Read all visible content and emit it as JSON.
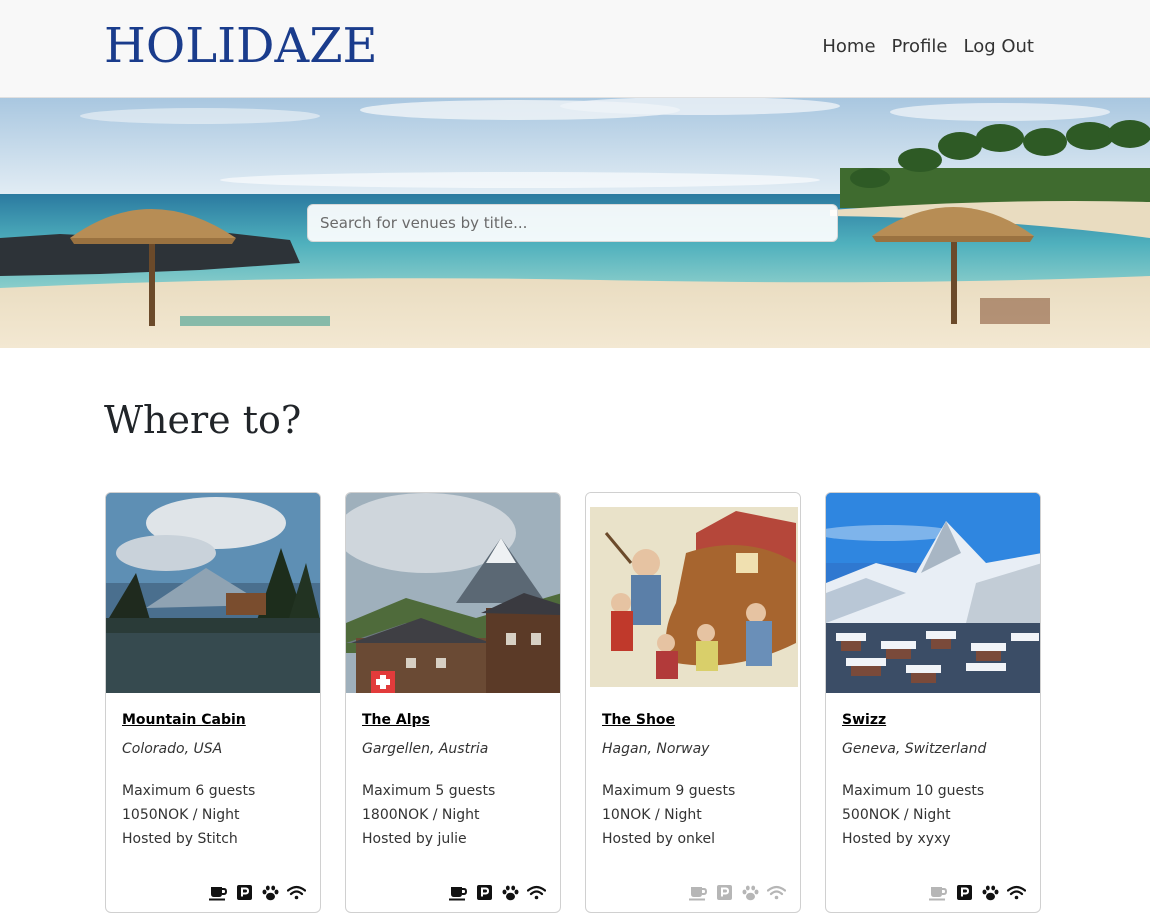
{
  "header": {
    "logo": "HOLIDAZE",
    "nav": [
      {
        "label": "Home"
      },
      {
        "label": "Profile"
      },
      {
        "label": "Log Out"
      }
    ]
  },
  "hero": {
    "search_placeholder": "Search for venues by title..."
  },
  "main": {
    "heading": "Where to?"
  },
  "venues": [
    {
      "title": "Mountain Cabin",
      "location": "Colorado, USA",
      "guests": "Maximum 6 guests",
      "price": "1050NOK / Night",
      "host": "Hosted by Stitch",
      "amenities": {
        "breakfast": true,
        "parking": true,
        "pets": true,
        "wifi": true
      }
    },
    {
      "title": "The Alps",
      "location": "Gargellen, Austria",
      "guests": "Maximum 5 guests",
      "price": "1800NOK / Night",
      "host": "Hosted by julie",
      "amenities": {
        "breakfast": true,
        "parking": true,
        "pets": true,
        "wifi": true
      }
    },
    {
      "title": "The Shoe",
      "location": "Hagan, Norway",
      "guests": "Maximum 9 guests",
      "price": "10NOK / Night",
      "host": "Hosted by onkel",
      "amenities": {
        "breakfast": false,
        "parking": false,
        "pets": false,
        "wifi": false
      }
    },
    {
      "title": "Swizz",
      "location": "Geneva, Switzerland",
      "guests": "Maximum 10 guests",
      "price": "500NOK / Night",
      "host": "Hosted by xyxy",
      "amenities": {
        "breakfast": false,
        "parking": true,
        "pets": true,
        "wifi": true
      }
    }
  ],
  "colors": {
    "brand": "#1a3c8c",
    "header_bg": "#f8f8f8",
    "text": "#212529"
  },
  "icons": [
    "coffee-icon",
    "parking-icon",
    "paw-icon",
    "wifi-icon"
  ]
}
